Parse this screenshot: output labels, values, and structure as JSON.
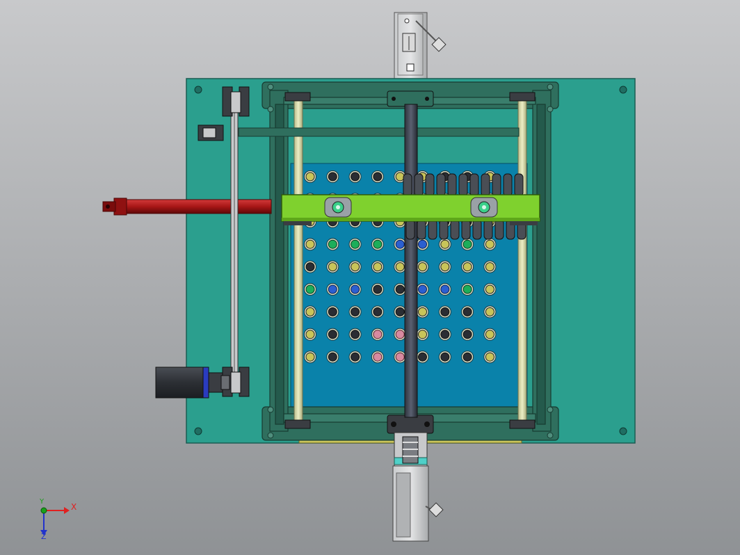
{
  "viewer": {
    "background_top": "#c8c9cb",
    "background_bottom": "#8f9295"
  },
  "colors": {
    "base_plate": "#2b9f8e",
    "tray": "#0a82aa",
    "frame": "#2f6f5e",
    "guide_rod": "#d8dba8",
    "gantry_beam": "#7fd12e",
    "cylinder": "#a81616",
    "ball_screw": "#3f4552",
    "motor_body": "#3a3d42",
    "motor_flange": "#2a3cc0",
    "lower_bar": "#c9c45a",
    "slot_purple": "#8a3fa0"
  },
  "grid": {
    "rows": 9,
    "cols": 9,
    "hole_colors": [
      [
        "yellow",
        "dark",
        "dark",
        "dark",
        "yellow",
        "yellow",
        "dark",
        "dark",
        "yellow"
      ],
      [
        "dark",
        "dark",
        "dark",
        "dark",
        "dark",
        "dark",
        "dark",
        "dark",
        "dark"
      ],
      [
        "yellow",
        "dark",
        "dark",
        "dark",
        "yellow",
        "yellow",
        "dark",
        "dark",
        "yellow"
      ],
      [
        "yellow",
        "green",
        "green",
        "green",
        "blue",
        "blue",
        "yellow",
        "green",
        "yellow"
      ],
      [
        "dark",
        "yellow",
        "yellow",
        "yellow",
        "yellow",
        "yellow",
        "yellow",
        "yellow",
        "yellow"
      ],
      [
        "green",
        "blue",
        "blue",
        "dark",
        "dark",
        "blue",
        "blue",
        "green",
        "yellow"
      ],
      [
        "yellow",
        "dark",
        "dark",
        "dark",
        "dark",
        "yellow",
        "dark",
        "dark",
        "yellow"
      ],
      [
        "yellow",
        "dark",
        "dark",
        "pink",
        "pink",
        "yellow",
        "dark",
        "dark",
        "yellow"
      ],
      [
        "yellow",
        "dark",
        "dark",
        "pink",
        "pink",
        "dark",
        "dark",
        "dark",
        "yellow"
      ]
    ]
  },
  "triad": {
    "x_label": "X",
    "y_label": "Y",
    "z_label": "Z"
  }
}
